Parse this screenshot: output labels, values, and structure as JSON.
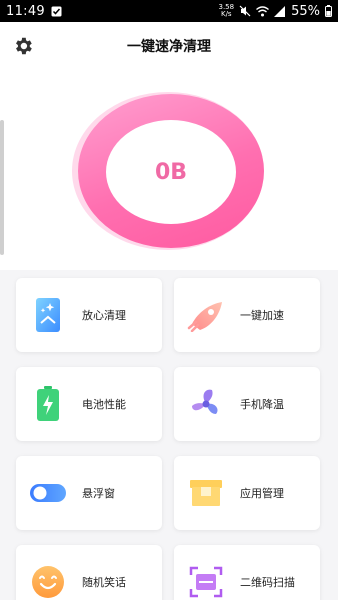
{
  "status_bar": {
    "time": "11:49",
    "net_speed_value": "3.58",
    "net_speed_unit": "K/s",
    "battery": "55%"
  },
  "header": {
    "title": "一键速净清理"
  },
  "cleaner": {
    "size_display": "0B"
  },
  "features": [
    {
      "label": "放心清理",
      "icon": "phone-clean-icon"
    },
    {
      "label": "一键加速",
      "icon": "rocket-icon"
    },
    {
      "label": "电池性能",
      "icon": "battery-icon"
    },
    {
      "label": "手机降温",
      "icon": "fan-icon"
    },
    {
      "label": "悬浮窗",
      "icon": "toggle-icon"
    },
    {
      "label": "应用管理",
      "icon": "app-box-icon"
    },
    {
      "label": "随机笑话",
      "icon": "smile-icon"
    },
    {
      "label": "二维码扫描",
      "icon": "scan-icon"
    }
  ],
  "colors": {
    "ring_pink": "#ff6fb0",
    "value_pink": "#f06aa5"
  }
}
